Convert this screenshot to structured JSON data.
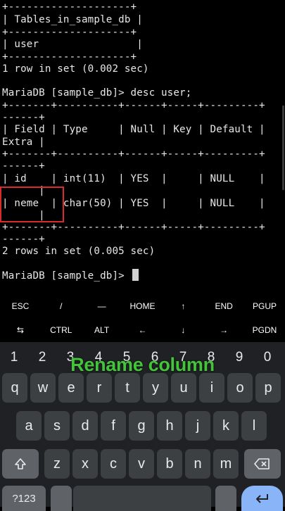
{
  "terminal": {
    "lines": [
      "+--------------------+",
      "| Tables_in_sample_db |",
      "+--------------------+",
      "| user                |",
      "+--------------------+",
      "1 row in set (0.002 sec)",
      "",
      "MariaDB [sample_db]> desc user;",
      "+-------+----------+------+-----+---------+",
      "------+",
      "| Field | Type     | Null | Key | Default |",
      "Extra |",
      "+-------+----------+------+-----+---------+",
      "------+",
      "| id    | int(11)  | YES  |     | NULL    |",
      "      |",
      "| neme  | char(50) | YES  |     | NULL    |",
      "      |",
      "+-------+----------+------+-----+---------+",
      "------+",
      "2 rows in set (0.005 sec)",
      "",
      "MariaDB [sample_db]> "
    ]
  },
  "extra_keys": {
    "row1": [
      "ESC",
      "/",
      "—",
      "HOME",
      "↑",
      "END",
      "PGUP"
    ],
    "row2": [
      "⇆",
      "CTRL",
      "ALT",
      "←",
      "↓",
      "→",
      "PGDN"
    ]
  },
  "keyboard": {
    "numbers": [
      "1",
      "2",
      "3",
      "4",
      "5",
      "6",
      "7",
      "8",
      "9",
      "0"
    ],
    "row1": [
      "q",
      "w",
      "e",
      "r",
      "t",
      "y",
      "u",
      "i",
      "o",
      "p"
    ],
    "row2": [
      "a",
      "s",
      "d",
      "f",
      "g",
      "h",
      "j",
      "k",
      "l"
    ],
    "row3": [
      "z",
      "x",
      "c",
      "v",
      "b",
      "n",
      "m"
    ],
    "sym_label": "?123",
    "icons": {
      "shift": "shift-arrow",
      "backspace": "backspace",
      "enter": "enter-arrow"
    },
    "colors": {
      "background": "#202124",
      "key": "#3c4043",
      "function_key": "#5f6368",
      "enter": "#8ab4f8"
    }
  },
  "overlay": {
    "caption": "Rename column",
    "caption_color": "#43c43a",
    "highlight_color": "#d92b2b"
  }
}
